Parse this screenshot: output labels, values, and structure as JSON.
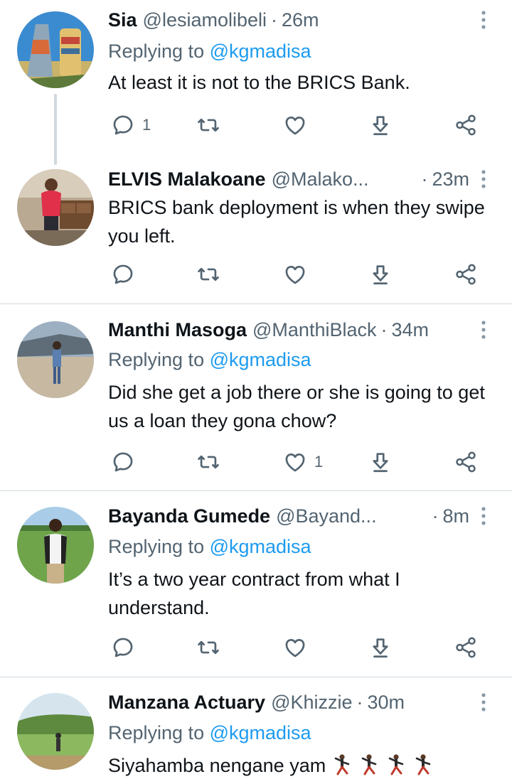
{
  "replies": [
    {
      "name": "Sia",
      "handle": "@lesiamolibeli",
      "separator": "·",
      "time": "26m",
      "replying_label": "Replying to",
      "replying_to": "@kgmadisa",
      "text": "At least it is not to the BRICS Bank.",
      "reply_count": "1",
      "like_count": "",
      "avatar": "avatar-sia"
    },
    {
      "name": "ELVIS Malakoane",
      "handle": "@Malako...",
      "separator": "·",
      "time": "23m",
      "replying_label": "",
      "replying_to": "",
      "text": "BRICS bank deployment is when they swipe you left.",
      "reply_count": "",
      "like_count": "",
      "avatar": "avatar-elvis"
    },
    {
      "name": "Manthi Masoga",
      "handle": "@ManthiBlack",
      "separator": "·",
      "time": "34m",
      "replying_label": "Replying to",
      "replying_to": "@kgmadisa",
      "text": "Did she get a job there or she is going to get us a loan they gona chow?",
      "reply_count": "",
      "like_count": "1",
      "avatar": "avatar-manthi"
    },
    {
      "name": "Bayanda Gumede",
      "handle": "@Bayand...",
      "separator": "·",
      "time": "8m",
      "replying_label": "Replying to",
      "replying_to": "@kgmadisa",
      "text": "It’s a two year contract from what I understand.",
      "reply_count": "",
      "like_count": "",
      "avatar": "avatar-bayanda"
    },
    {
      "name": "Manzana Actuary",
      "handle": "@Khizzie",
      "separator": "·",
      "time": "30m",
      "replying_label": "Replying to",
      "replying_to": "@kgmadisa",
      "text": "Siyahamba nengane yam",
      "emoji": "dancing-person-emoji",
      "emoji_count": 4,
      "avatar": "avatar-manzana"
    }
  ],
  "icons": {
    "reply": "reply-icon",
    "retweet": "retweet-icon",
    "like": "like-icon",
    "share": "share-icon",
    "more": "share-network-icon",
    "overflow": "more-vertical-icon"
  },
  "colors": {
    "text_primary": "#0f1419",
    "text_secondary": "#536471",
    "link": "#1d9bf0",
    "divider": "#cfd9de"
  }
}
